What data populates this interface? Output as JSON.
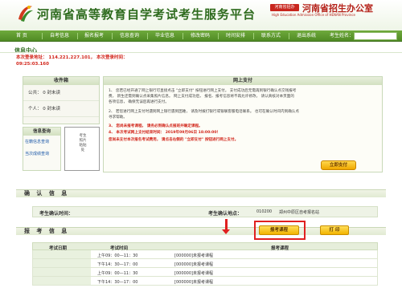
{
  "header": {
    "site_title": "河南省高等教育自学考试考生服务平台",
    "office_badge": "河南省招办",
    "office_name": "河南省招生办公室",
    "office_en": "High Education Admission Office of HENAN Province"
  },
  "nav": {
    "items": [
      "首 页",
      "自考信息",
      "报名报考",
      "信息查询",
      "毕业信息",
      "修改密码",
      "时间安排",
      "联系方式",
      "退出系统"
    ],
    "search_label": "考生姓名："
  },
  "info": {
    "section_title": "信息中心",
    "login_line1": "本次登录地址： 114.221.227.101， 本次登录时间：",
    "login_line2": "09:25:03.160"
  },
  "inbox": {
    "title": "收件箱",
    "public_label": "公共： 0 封未读",
    "personal_label": "个人： 0 封未读"
  },
  "query": {
    "title": "信息查询",
    "link1": "在籍信息查询",
    "link2": "当次成绩查询"
  },
  "photo": {
    "text": "考生照片粘贴处"
  },
  "payment": {
    "title": "网上支付",
    "lines": [
      "1、 您若已经开通了网上银行可直接点击 \"立即支付\" 按钮进行网上支付。 支付成功后无需再到银行确认点交钱报考",
      "    费， 新生还需到确认点采集照片信息。 网上支付成功后， 报名、报考信息将不再允许修改， 请认真核对本页面的",
      "    各项信息， 确保无误后再进行支付。",
      "2、 若您进行网上支付时遇到网上银行遇到困难， 请及时拨打银行或银联客服电话联系。 也可在确认时间内到确认点",
      "    寻求帮助。",
      "3、 您尚未报考课程， 请务必到确认点报班并确定课程。",
      "4、 本次考试网上支付结束时间： 2019年09月06日 18:00:00！",
      "    您尚未支付本次报名考试费用， 请点击右侧的 \"立即支付\" 按钮进行网上支付。"
    ],
    "pay_button": "立即支付"
  },
  "confirm": {
    "title": "确 认 信 息",
    "time_label": "考生确认时间：",
    "place_label": "考生确认地点：",
    "place_code": "010200",
    "place_name": "郑州中原区自考报名站"
  },
  "exam": {
    "title": "报 考 信 息",
    "report_button": "报考课程",
    "print_button": "打  印",
    "columns": [
      "考试日期",
      "考试时间",
      "报考课程"
    ],
    "rows": [
      {
        "time": "上午09：00—11：30",
        "course": "[000000]未报考课程"
      },
      {
        "time": "下午14：30—17：00",
        "course": "[000000]未报考课程"
      },
      {
        "time": "上午09：00—11：30",
        "course": "[000000]未报考课程"
      },
      {
        "time": "下午14：30—17：00",
        "course": "[000000]未报考课程"
      }
    ]
  }
}
